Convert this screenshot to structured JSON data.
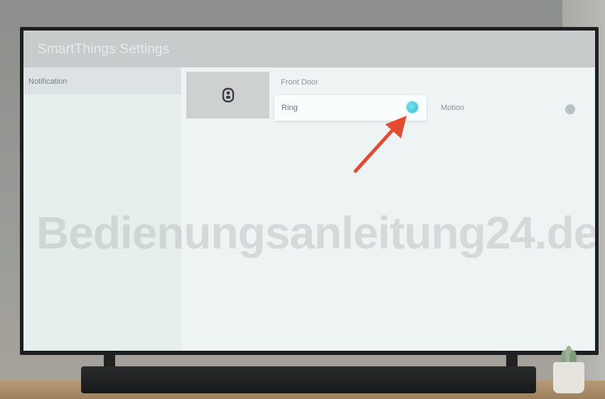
{
  "app": {
    "title": "SmartThings Settings"
  },
  "sidebar": {
    "header_label": "Notification"
  },
  "device": {
    "icon": "doorbell-icon",
    "name": "Front Door",
    "options": [
      {
        "label": "Ring",
        "state": "on"
      },
      {
        "label": "Motion",
        "state": "off"
      }
    ]
  },
  "overlay": {
    "watermark": "Bedienungsanleitung24.de"
  },
  "colors": {
    "toggle_on": "#2ab9cb",
    "toggle_off": "#b9c0c2",
    "arrow": "#e24a32"
  }
}
